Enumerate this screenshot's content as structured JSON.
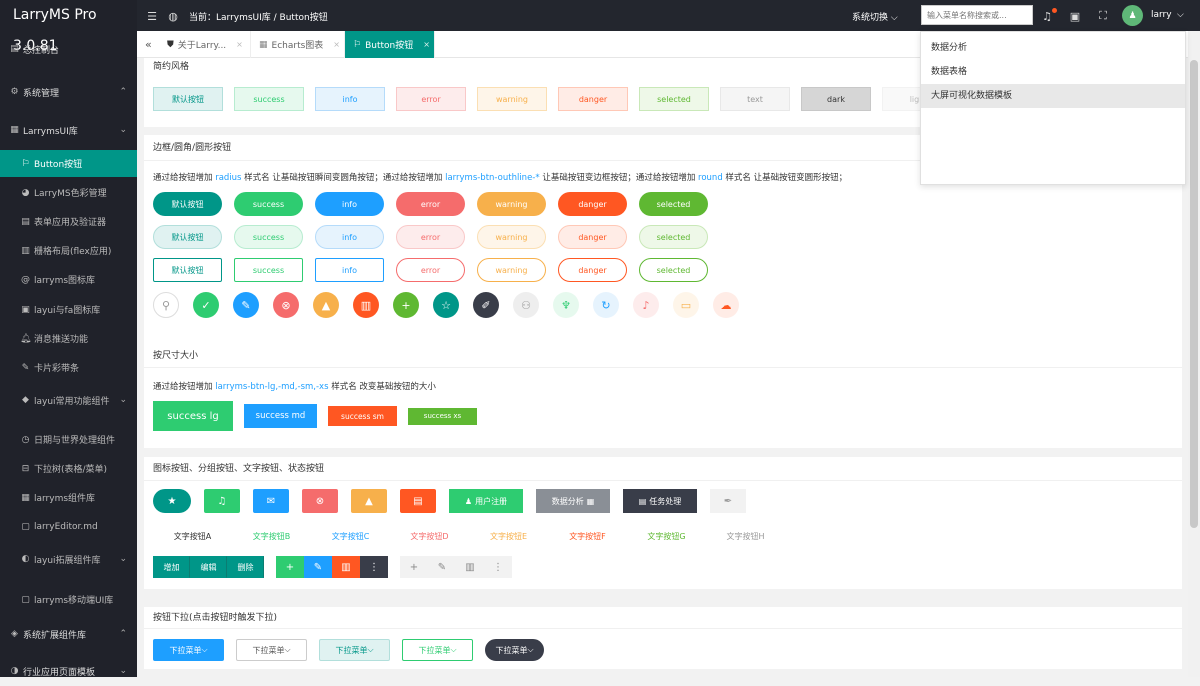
{
  "app": {
    "title": "LarryMS Pro 3.0.81",
    "breadcrumb": "当前：LarrymsUI库 / Button按钮",
    "system_switch": "系统切换",
    "search_placeholder": "输入菜单名称搜索或...",
    "user": "larry",
    "accent": "#009688"
  },
  "sidebar": {
    "items": [
      {
        "label": "总控制台",
        "icon": "dashboard-icon"
      },
      {
        "label": "系统管理",
        "icon": "system-icon"
      },
      {
        "label": "LarrymsUI库",
        "icon": "grid-icon"
      },
      {
        "label": "Button按钮",
        "icon": "button-icon"
      },
      {
        "label": "LarryMS色彩管理",
        "icon": "palette-icon"
      },
      {
        "label": "表单应用及验证器",
        "icon": "form-icon"
      },
      {
        "label": "栅格布局(flex应用)",
        "icon": "layout-icon"
      },
      {
        "label": "larryms图标库",
        "icon": "at-icon"
      },
      {
        "label": "layui与fa图标库",
        "icon": "icons-icon"
      },
      {
        "label": "消息推送功能",
        "icon": "bell-icon"
      },
      {
        "label": "卡片彩带条",
        "icon": "card-icon"
      },
      {
        "label": "layui常用功能组件",
        "icon": "layers-icon"
      },
      {
        "label": "日期与世界处理组件",
        "icon": "clock-icon"
      },
      {
        "label": "下拉树(表格/菜单)",
        "icon": "tree-icon"
      },
      {
        "label": "larryms组件库",
        "icon": "component-icon"
      },
      {
        "label": "larryEditor.md",
        "icon": "editor-icon"
      },
      {
        "label": "layui拓展组件库",
        "icon": "extend-icon"
      },
      {
        "label": "larryms移动端UI库",
        "icon": "mobile-icon"
      },
      {
        "label": "系统扩展组件库",
        "icon": "plugin-icon"
      },
      {
        "label": "行业应用页面模板",
        "icon": "template-icon"
      }
    ]
  },
  "tabs": [
    {
      "label": "关于Larry...",
      "close": "×"
    },
    {
      "label": "Echarts图表",
      "close": "×"
    },
    {
      "label": "Button按钮",
      "close": "×"
    }
  ],
  "dropdown": {
    "items": [
      "数据分析",
      "数据表格",
      "大屏可视化数据模板"
    ]
  },
  "sections": {
    "simple": {
      "title": "简约风格",
      "buttons": [
        "默认按钮",
        "success",
        "info",
        "error",
        "warning",
        "danger",
        "selected",
        "text",
        "dark",
        "ligh"
      ]
    },
    "border": {
      "title": "边框/圆角/圆形按钮",
      "desc1": "通过给按钮增加 ",
      "desc1_hl": "radius",
      "desc2": " 样式名 让基础按钮瞬间变圆角按钮；通过给按钮增加 ",
      "desc2_hl": "larryms-btn-outhline-*",
      "desc3": " 让基础按钮变边框按钮；通过给按钮增加 ",
      "desc3_hl": "round",
      "desc4": " 样式名 让基础按钮变圆形按钮；",
      "buttons": [
        "默认按钮",
        "success",
        "info",
        "error",
        "warning",
        "danger",
        "selected"
      ]
    },
    "size": {
      "title": "按尺寸大小",
      "desc1": "通过给按钮增加 ",
      "desc_hl": "larryms-btn-lg,-md,-sm,-xs",
      "desc2": " 样式名 改变基础按钮的大小",
      "buttons": [
        "success lg",
        "success md",
        "success sm",
        "success xs"
      ]
    },
    "icons": {
      "title": "图标按钮、分组按钮、文字按钮、状态按钮",
      "labeled": [
        "用户注册",
        "数据分析",
        "任务处理"
      ],
      "text_buttons": [
        "文字按钮A",
        "文字按钮B",
        "文字按钮C",
        "文字按钮D",
        "文字按钮E",
        "文字按钮F",
        "文字按钮G",
        "文字按钮H"
      ],
      "group": [
        "增加",
        "编辑",
        "删除"
      ]
    },
    "dropdown": {
      "title": "按钮下拉(点击按钮时触发下拉)",
      "buttons": [
        "下拉菜单",
        "下拉菜单",
        "下拉菜单",
        "下拉菜单",
        "下拉菜单"
      ]
    }
  }
}
